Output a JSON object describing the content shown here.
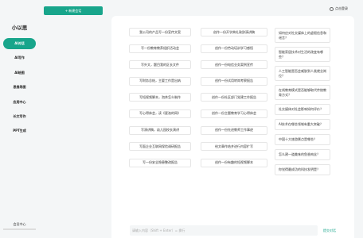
{
  "sidebar": {
    "brand": "小以思",
    "items": [
      {
        "label": "AI对话",
        "active": true
      },
      {
        "label": "AI写作",
        "active": false
      },
      {
        "label": "AI绘图",
        "active": false
      },
      {
        "label": "思维导图",
        "active": false
      },
      {
        "label": "应用中心",
        "active": false
      },
      {
        "label": "长文写作",
        "active": false
      },
      {
        "label": "PPT生成",
        "active": false
      }
    ],
    "member_label": "会员中心"
  },
  "header": {
    "new_chat_label": "+ 新建会话",
    "login_label": "点击登录"
  },
  "suggestions": {
    "col1": [
      "我公司的产品写一份宣传文案",
      "写一份教育教养组织活动会",
      "写外文，题目我的区长文件",
      "写财务总结，主要工作是出纳",
      "写短视频脚本，泡茶怎么制作",
      "写心得体会，读《夏洛的网》",
      "写演讲稿，幼儿园校长演讲",
      "写面企业互联网保险调研报告",
      "写一份安全隐患整改报告"
    ],
    "col2": [
      "创作一份开学典礼致辞演讲稿",
      "创作一份劳动培训学习感悟",
      "创作一份电信业务案例宣传",
      "创作一份试用转岗考察报告",
      "创作一份社区部门党建工作报告",
      "创作一份主题教育学习心得体会",
      "创作一份先进教师工作事迹",
      "给文章作结并进行内容扩写",
      "创作一份有趣的短视频脚本"
    ],
    "col3": [
      "如何应对社交媒体上的虚假信息和谣言？",
      "智能家居技术对生活的改变有哪些？",
      "人工智能是否会威胁到人类就业岗位？",
      "在线教育模式是否能够取代传统教育方式？",
      "社交媒体对社会影响如何评价？",
      "AI技术在哪些领域有重大突破？",
      "中国十大旅游景点是哪些？",
      "怎么建一道美味的鱼香肉丝？",
      "你觉得最成功的科技发明是？"
    ]
  },
  "input": {
    "placeholder": "请输入内容（Shift + Enter）= 换行",
    "send_label": "提交对话"
  }
}
